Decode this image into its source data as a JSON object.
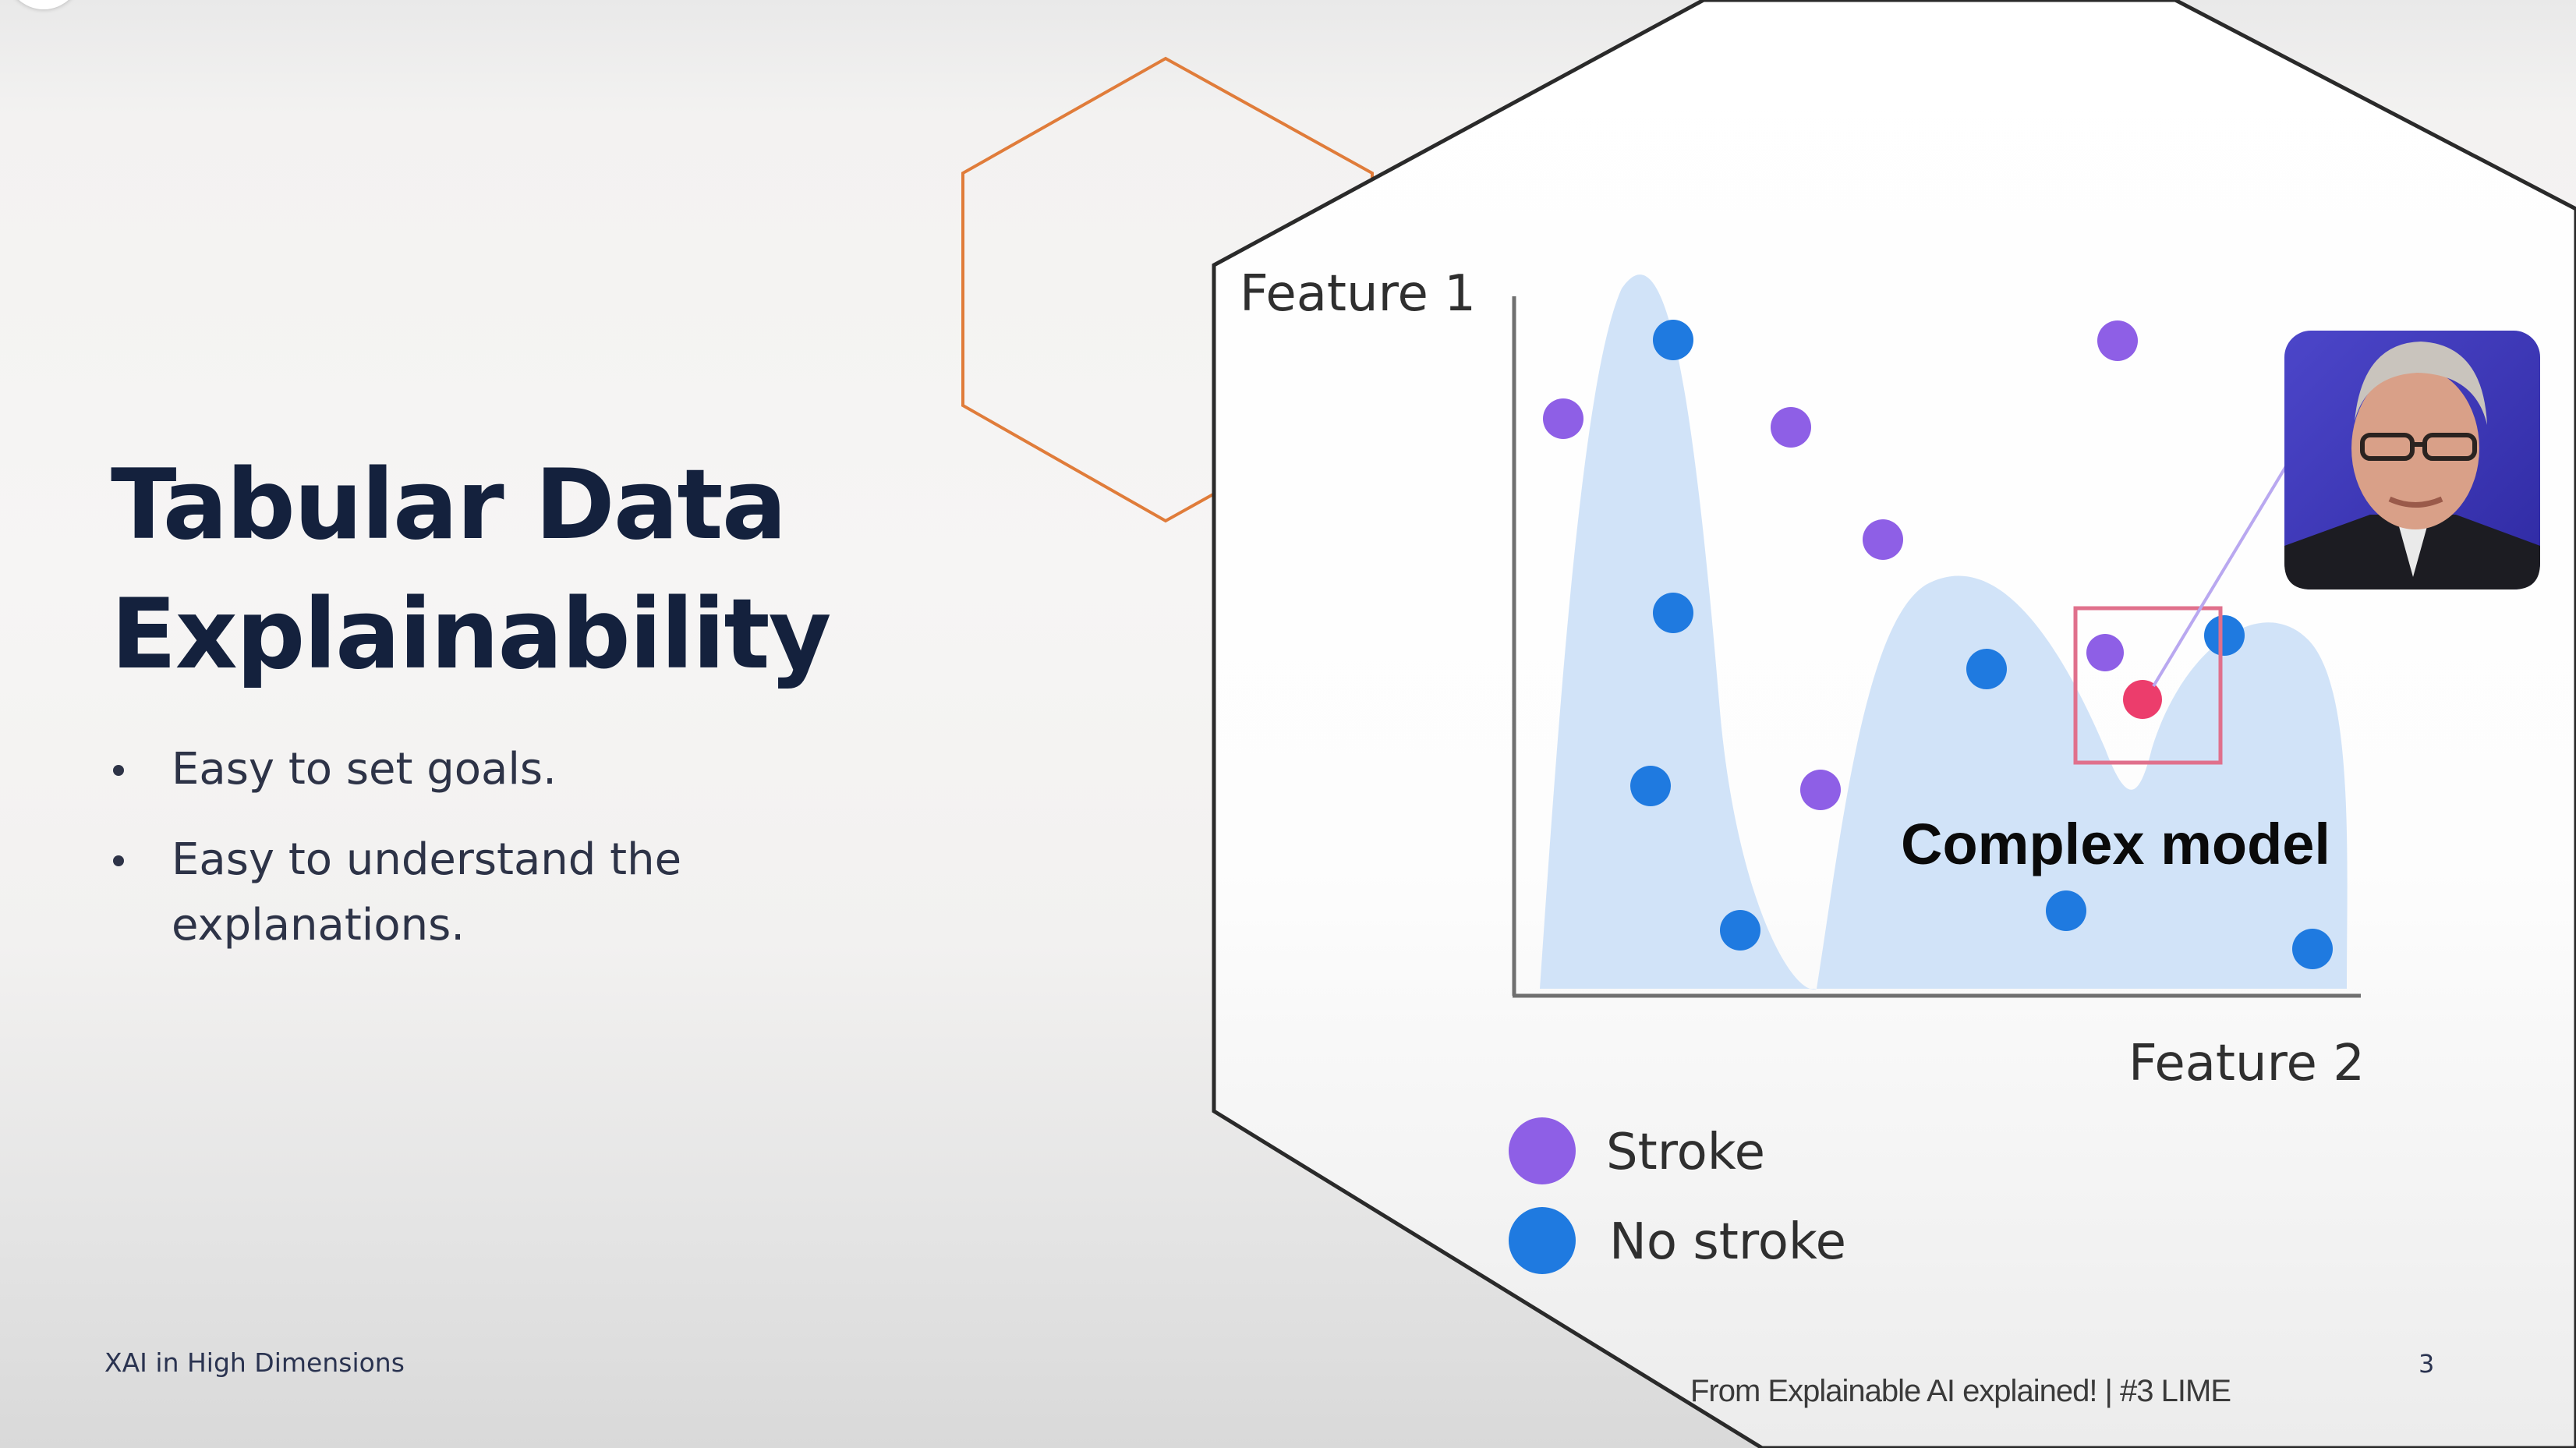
{
  "slide": {
    "title_line1": "Tabular Data",
    "title_line2": "Explainability",
    "bullets": [
      "Easy to set goals.",
      "Easy to understand the explanations."
    ],
    "footer_left": "XAI in High Dimensions",
    "footer_source": "From Explainable AI explained! | #3 LIME",
    "page_number": "3"
  },
  "figure": {
    "y_axis_label": "Feature 1",
    "x_axis_label": "Feature 2",
    "model_label": "Complex model",
    "legend": [
      {
        "label": "Stroke",
        "color": "#8e5fe6"
      },
      {
        "label": "No stroke",
        "color": "#1f7ae0"
      }
    ],
    "presenter_photo": "presenter-portrait",
    "colors": {
      "stroke": "#8e5fe6",
      "no_stroke": "#1f7ae0",
      "highlight_point": "#ec3d6c",
      "decision_region": "#cfe2f8",
      "hexagon_accent": "#e07c3a"
    }
  }
}
